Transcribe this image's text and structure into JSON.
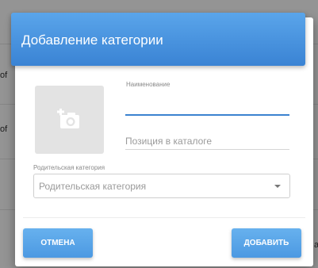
{
  "background": {
    "fragments": [
      "of",
      "of",
      "a"
    ]
  },
  "dialog": {
    "title": "Добавление категории",
    "photo_icon": "add-photo-icon",
    "name_field": {
      "label": "Наименование",
      "value": ""
    },
    "position_field": {
      "placeholder": "Позиция в каталоге",
      "value": ""
    },
    "parent_select": {
      "label": "Родительская категория",
      "value": "Родительская категория"
    },
    "buttons": {
      "cancel": "ОТМЕНА",
      "add": "ДОБАВИТЬ"
    }
  },
  "colors": {
    "accent": "#3b82d0",
    "header": "#4a94e0",
    "button": "#5aa5ea"
  }
}
